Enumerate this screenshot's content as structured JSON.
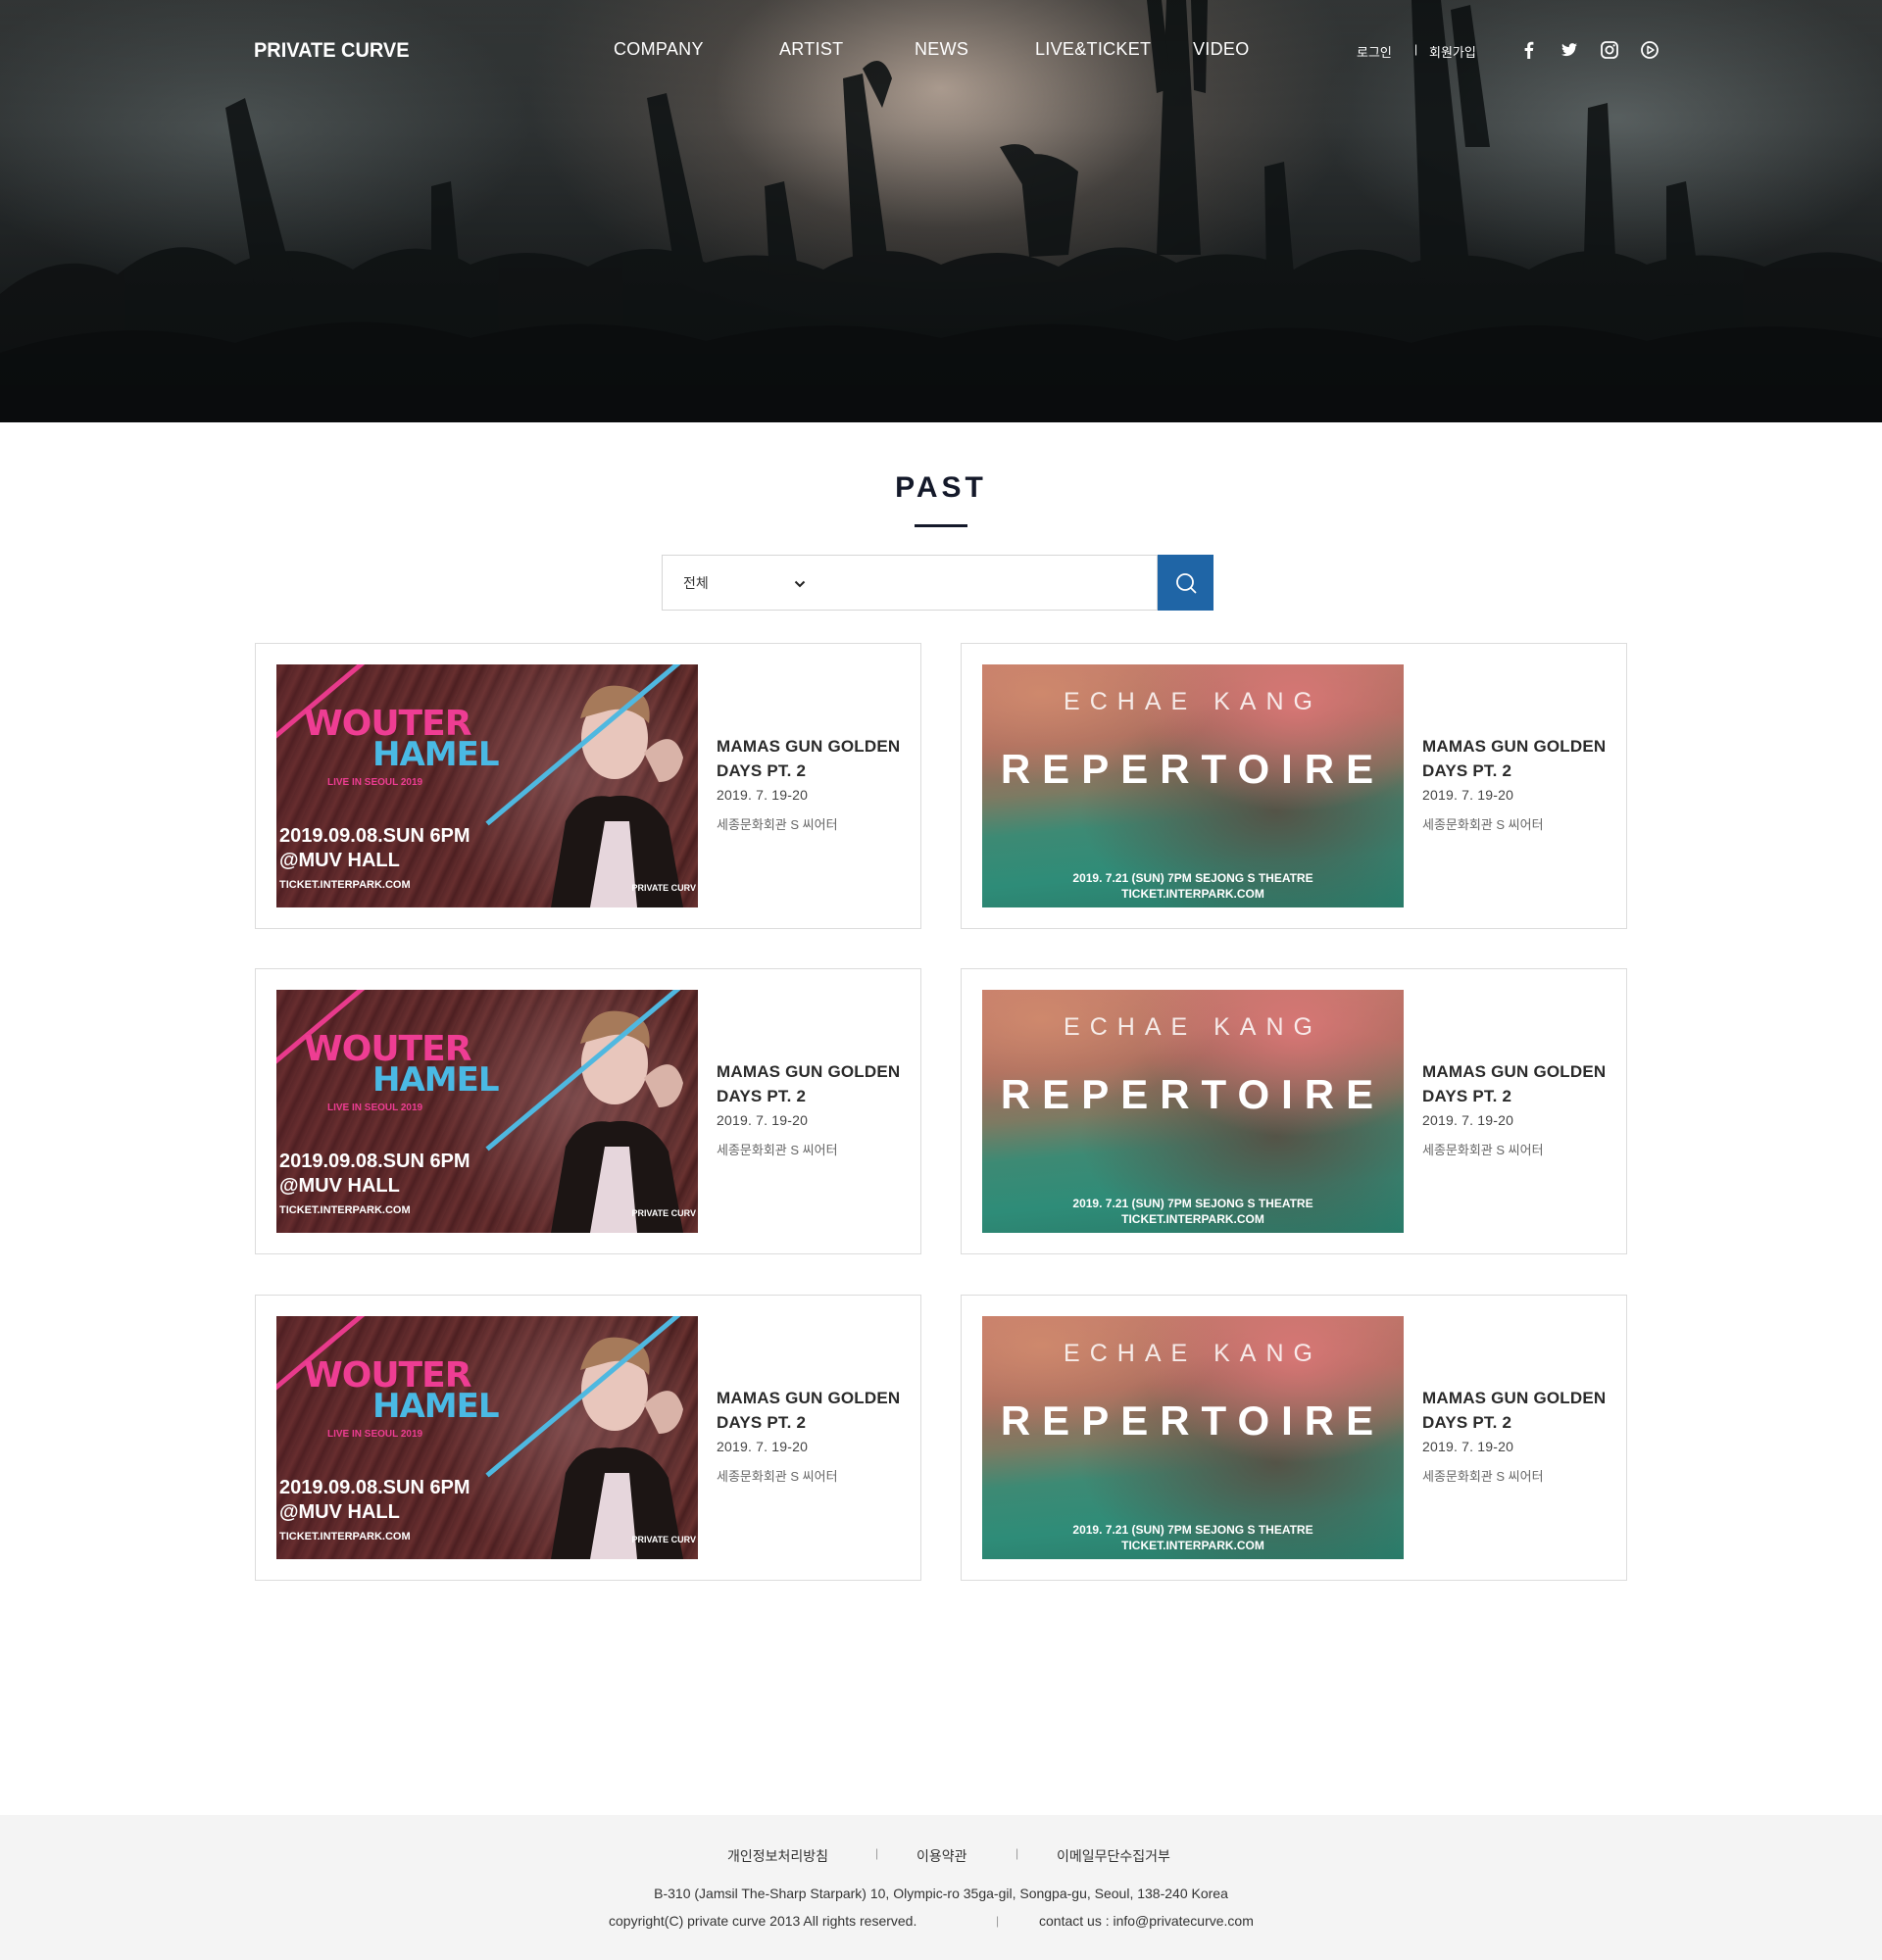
{
  "header": {
    "logo": "PRIVATE CURVE",
    "nav": [
      "COMPANY",
      "ARTIST",
      "NEWS",
      "LIVE&TICKET",
      "VIDEO"
    ],
    "login": "로그인",
    "separator": "|",
    "signup": "회원가입",
    "social_icons": [
      "facebook-icon",
      "twitter-icon",
      "instagram-icon",
      "play-icon"
    ]
  },
  "section": {
    "title": "PAST"
  },
  "search": {
    "category": "전체",
    "value": "",
    "placeholder": ""
  },
  "poster_a": {
    "line1": "WOUTER",
    "line2": "HAMEL",
    "tagline": "LIVE IN SEOUL 2019",
    "date": "2019.09.08.SUN 6PM",
    "venue": "@MUV HALL",
    "site": "TICKET.INTERPARK.COM",
    "brand": "PRIVATE CURV"
  },
  "poster_b": {
    "artist": "ECHAE KANG",
    "title": "REPERTOIRE",
    "line1": "2019. 7.21 (SUN) 7PM SEJONG S THEATRE",
    "line2": "TICKET.INTERPARK.COM"
  },
  "cards": [
    {
      "title_1": "MAMAS GUN GOLDEN",
      "title_2": "DAYS PT. 2",
      "date": "2019. 7. 19-20",
      "venue": "세종문화회관 S 씨어터"
    },
    {
      "title_1": "MAMAS GUN GOLDEN",
      "title_2": "DAYS PT. 2",
      "date": "2019. 7. 19-20",
      "venue": "세종문화회관 S 씨어터"
    },
    {
      "title_1": "MAMAS GUN GOLDEN",
      "title_2": "DAYS PT. 2",
      "date": "2019. 7. 19-20",
      "venue": "세종문화회관 S 씨어터"
    },
    {
      "title_1": "MAMAS GUN GOLDEN",
      "title_2": "DAYS PT. 2",
      "date": "2019. 7. 19-20",
      "venue": "세종문화회관 S 씨어터"
    },
    {
      "title_1": "MAMAS GUN GOLDEN",
      "title_2": "DAYS PT. 2",
      "date": "2019. 7. 19-20",
      "venue": "세종문화회관 S 씨어터"
    },
    {
      "title_1": "MAMAS GUN GOLDEN",
      "title_2": "DAYS PT. 2",
      "date": "2019. 7. 19-20",
      "venue": "세종문화회관 S 씨어터"
    }
  ],
  "footer": {
    "links": [
      "개인정보처리방침",
      "이용약관",
      "이메일무단수집거부"
    ],
    "separator": "|",
    "address": "B-310 (Jamsil The-Sharp Starpark) 10, Olympic-ro 35ga-gil, Songpa-gu, Seoul, 138-240 Korea",
    "copyright": "copyright(C) private curve 2013 All rights reserved.",
    "contact": "contact us : info@privatecurve.com"
  },
  "colors": {
    "accent": "#1f65a6",
    "title": "#14192a",
    "poster_pink": "#ee3d93",
    "poster_blue": "#4ab9e4"
  }
}
